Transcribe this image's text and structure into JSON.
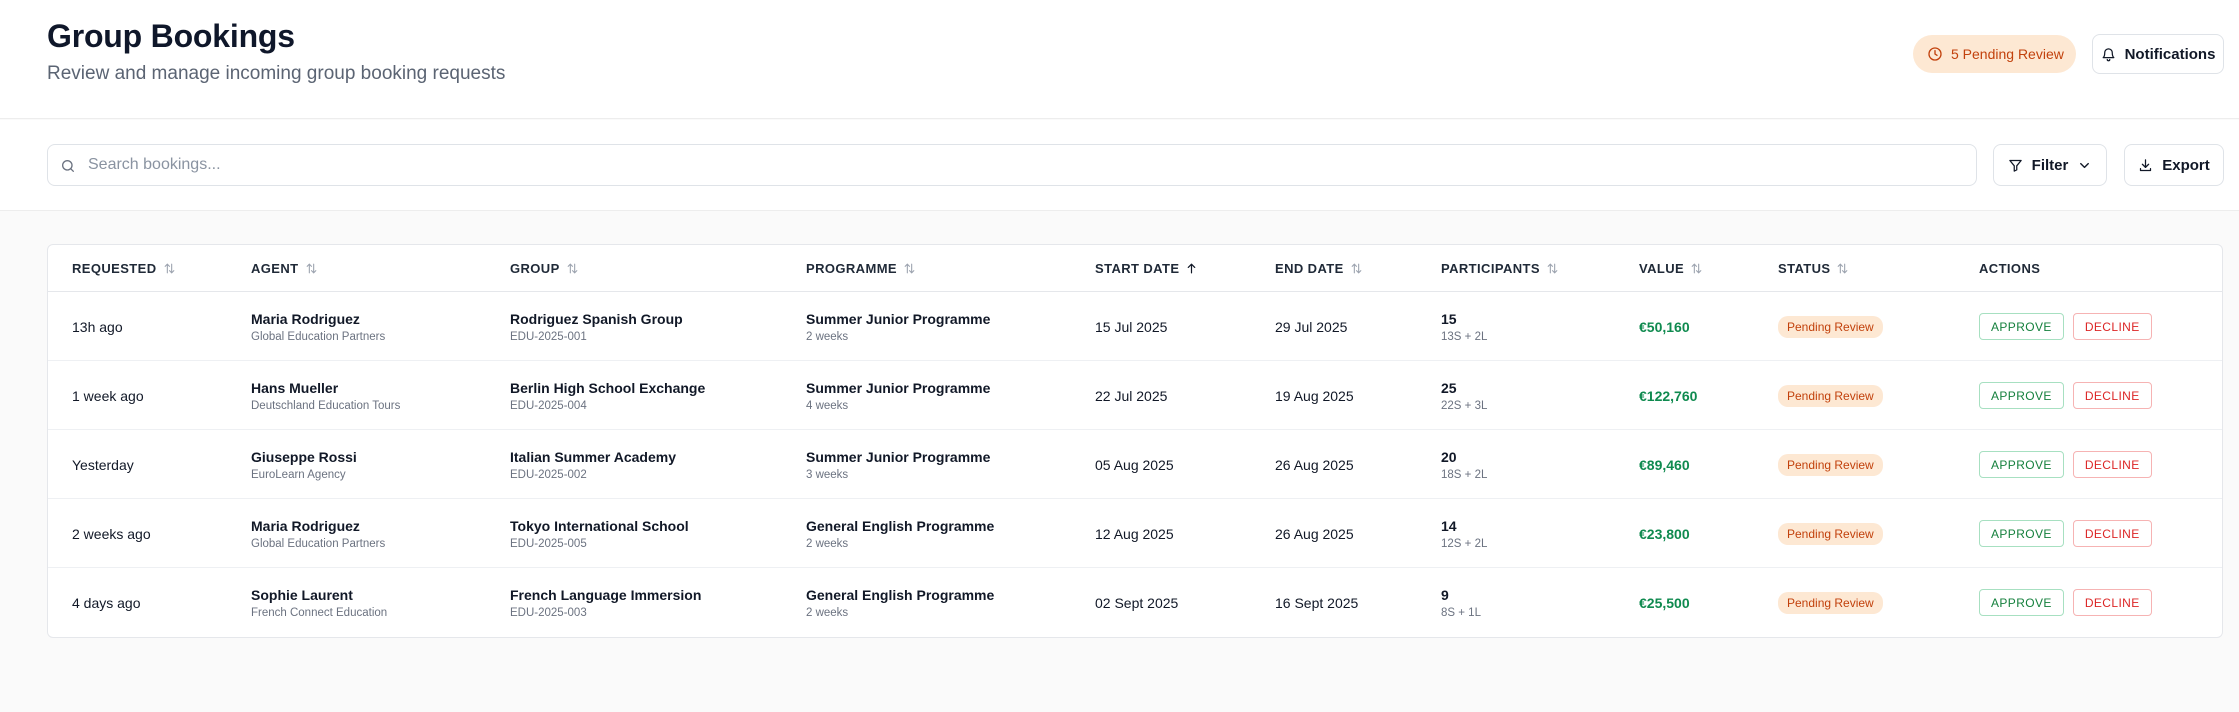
{
  "header": {
    "title": "Group Bookings",
    "subtitle": "Review and manage incoming group booking requests",
    "pending_label": "5 Pending Review",
    "notifications_label": "Notifications"
  },
  "toolbar": {
    "search_placeholder": "Search bookings...",
    "filter_label": "Filter",
    "export_label": "Export"
  },
  "table": {
    "columns": {
      "requested": "REQUESTED",
      "agent": "AGENT",
      "group": "GROUP",
      "programme": "PROGRAMME",
      "start_date": "START DATE",
      "end_date": "END DATE",
      "participants": "PARTICIPANTS",
      "value": "VALUE",
      "status": "STATUS",
      "actions": "ACTIONS"
    },
    "sorted_column": "start_date",
    "approve_label": "APPROVE",
    "decline_label": "DECLINE",
    "rows": [
      {
        "requested": "13h ago",
        "agent": "Maria Rodriguez",
        "agency": "Global Education Partners",
        "group": "Rodriguez Spanish Group",
        "code": "EDU-2025-001",
        "programme": "Summer Junior Programme",
        "duration": "2 weeks",
        "start": "15 Jul 2025",
        "end": "29 Jul 2025",
        "participants": "15",
        "breakdown": "13S + 2L",
        "value": "€50,160",
        "status": "Pending Review"
      },
      {
        "requested": "1 week ago",
        "agent": "Hans Mueller",
        "agency": "Deutschland Education Tours",
        "group": "Berlin High School Exchange",
        "code": "EDU-2025-004",
        "programme": "Summer Junior Programme",
        "duration": "4 weeks",
        "start": "22 Jul 2025",
        "end": "19 Aug 2025",
        "participants": "25",
        "breakdown": "22S + 3L",
        "value": "€122,760",
        "status": "Pending Review"
      },
      {
        "requested": "Yesterday",
        "agent": "Giuseppe Rossi",
        "agency": "EuroLearn Agency",
        "group": "Italian Summer Academy",
        "code": "EDU-2025-002",
        "programme": "Summer Junior Programme",
        "duration": "3 weeks",
        "start": "05 Aug 2025",
        "end": "26 Aug 2025",
        "participants": "20",
        "breakdown": "18S + 2L",
        "value": "€89,460",
        "status": "Pending Review"
      },
      {
        "requested": "2 weeks ago",
        "agent": "Maria Rodriguez",
        "agency": "Global Education Partners",
        "group": "Tokyo International School",
        "code": "EDU-2025-005",
        "programme": "General English Programme",
        "duration": "2 weeks",
        "start": "12 Aug 2025",
        "end": "26 Aug 2025",
        "participants": "14",
        "breakdown": "12S + 2L",
        "value": "€23,800",
        "status": "Pending Review"
      },
      {
        "requested": "4 days ago",
        "agent": "Sophie Laurent",
        "agency": "French Connect Education",
        "group": "French Language Immersion",
        "code": "EDU-2025-003",
        "programme": "General English Programme",
        "duration": "2 weeks",
        "start": "02 Sept 2025",
        "end": "16 Sept 2025",
        "participants": "9",
        "breakdown": "8S + 1L",
        "value": "€25,500",
        "status": "Pending Review"
      }
    ]
  },
  "colors": {
    "title": "#0f172a",
    "pending_bg": "#fde8d3",
    "pending_text": "#c2410c",
    "value_green": "#0f8a4f",
    "approve_green": "#15803d",
    "decline_red": "#dc2626"
  },
  "icons": {
    "pending": "clock-icon",
    "notifications": "bell-icon",
    "search": "search-icon",
    "filter": "filter-icon",
    "filter_chevron": "chevron-down-icon",
    "export": "download-icon",
    "sortable": "sort-icon",
    "sorted": "sort-ascending-icon"
  }
}
